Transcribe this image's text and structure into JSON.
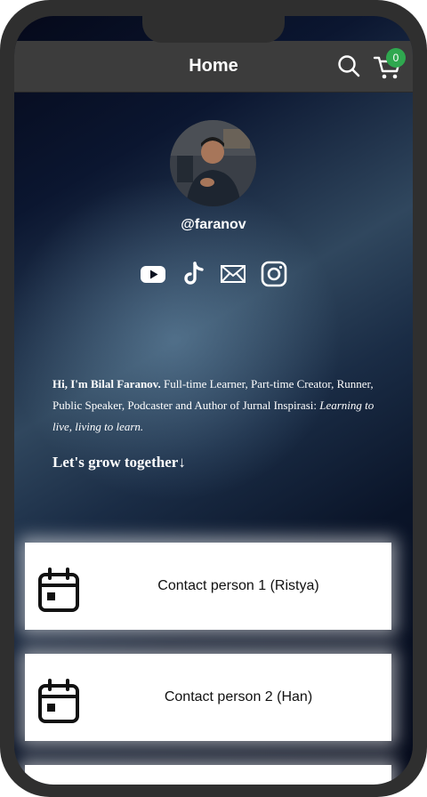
{
  "header": {
    "title": "Home",
    "cart_count": "0"
  },
  "profile": {
    "username": "@faranov"
  },
  "social_icons": [
    "youtube-icon",
    "tiktok-icon",
    "mail-icon",
    "instagram-icon"
  ],
  "bio": {
    "intro_bold": "Hi, I'm Bilal Faranov.",
    "intro_text": " Full-time Learner, Part-time Creator, Runner, Public Speaker, Podcaster and Author of Jurnal Inspirasi: ",
    "intro_italic": "Learning to live, living to learn.",
    "cta": "Let's grow together↓"
  },
  "links": [
    {
      "label": "Contact person 1 (Ristya)",
      "icon": "calendar-icon"
    },
    {
      "label": "Contact person 2 (Han)",
      "icon": "calendar-icon"
    }
  ],
  "colors": {
    "badge": "#2fa84f",
    "topbar": "#3c3c3c",
    "background_dark": "#050a1a"
  }
}
